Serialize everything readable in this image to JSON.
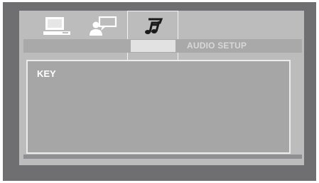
{
  "tabs": [
    {
      "icon": "monitor-icon",
      "selected": false
    },
    {
      "icon": "user-speech-icon",
      "selected": false
    },
    {
      "icon": "music-notes-icon",
      "selected": true
    }
  ],
  "header": {
    "title": "AUDIO SETUP"
  },
  "menu": {
    "selected_item": "KEY"
  }
}
